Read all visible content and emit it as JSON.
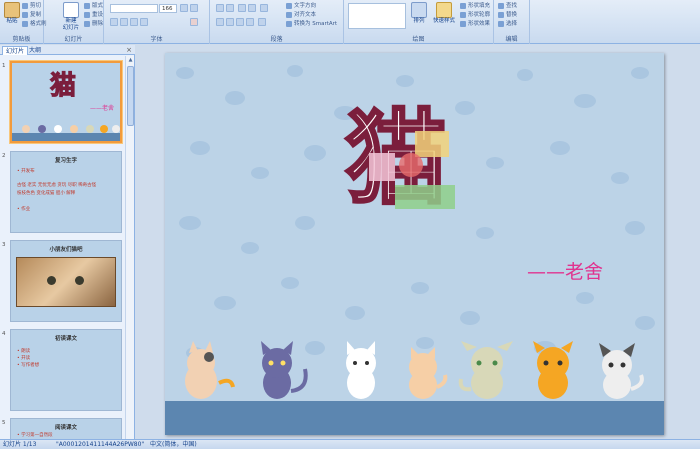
{
  "ribbon": {
    "clipboard": {
      "label": "剪贴板",
      "paste": "粘贴",
      "cut": "剪切",
      "copy": "复制",
      "format_painter": "格式刷"
    },
    "slides": {
      "label": "幻灯片",
      "new_slide": "新建\n幻灯片",
      "layout": "版式",
      "reset": "重设",
      "delete": "删除"
    },
    "font": {
      "label": "字体",
      "font_size": "166"
    },
    "paragraph": {
      "label": "段落",
      "text_direction": "文字方向",
      "align_text": "对齐文本",
      "smartart": "转换为 SmartArt"
    },
    "drawing": {
      "label": "绘图",
      "arrange": "排列",
      "quick_styles": "快速样式",
      "shape_fill": "形状填充",
      "shape_outline": "形状轮廓",
      "shape_effects": "形状效果"
    },
    "editing": {
      "label": "编辑",
      "find": "查找",
      "replace": "替换",
      "select": "选择"
    }
  },
  "panel": {
    "tab_slides": "幻灯片",
    "tab_outline": "大纲",
    "close": "×",
    "thumbnails": [
      {
        "num": "1",
        "title": "猫",
        "subtitle": "——老舍"
      },
      {
        "num": "2",
        "title": "复习生字",
        "lines": [
          "• 开发布",
          "古怪  老实  无忧无虑  贪玩  尽职  稀奇古怪",
          "枝枝色色  变化成猫  胆小  解释",
          "• 作业"
        ]
      },
      {
        "num": "3",
        "title": "小朋友们猫吧"
      },
      {
        "num": "4",
        "title": "初读课文",
        "lines": [
          "• 朗读",
          "• 开读",
          "• 写作者想"
        ]
      },
      {
        "num": "5",
        "title": "阅读课文",
        "lines": [
          "• 学习第一自然段"
        ]
      }
    ]
  },
  "slide": {
    "title": "猫",
    "author": "——老舍"
  },
  "status": {
    "slide_info": "幻灯片 1/13",
    "theme": "\"A0001201411144A26PW80\"",
    "language": "中文(简体，中国)"
  },
  "colors": {
    "slide_bg": "#bcd3e7",
    "title_outline": "#7b1e3c",
    "author": "#e0338f",
    "selection": "#f29b3c"
  }
}
